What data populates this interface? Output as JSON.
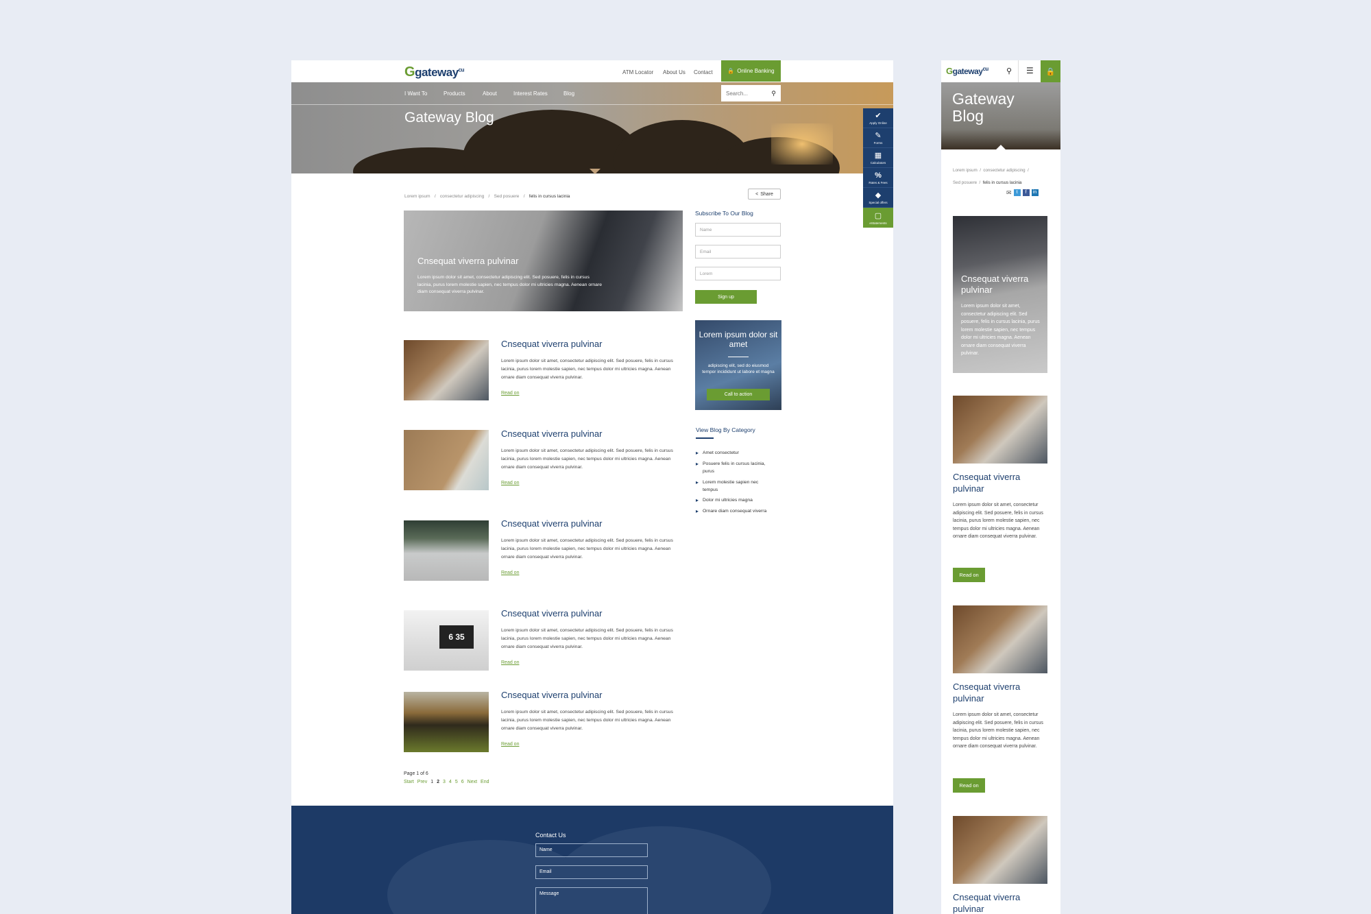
{
  "desktop": {
    "logo": {
      "mark": "G",
      "name": "gateway",
      "sup": "cu"
    },
    "top_links": [
      "ATM Locator",
      "About Us",
      "Contact"
    ],
    "online_banking": "Online Banking",
    "nav": [
      "I Want To",
      "Products",
      "About",
      "Interest Rates",
      "Blog"
    ],
    "search_placeholder": "Search...",
    "hero_title": "Gateway Blog",
    "breadcrumb": [
      "Lorem ipsum",
      "consectetur adipiscing",
      "Sed posuere",
      "felis in cursus lacinia"
    ],
    "share": "Share",
    "featured": {
      "title": "Cnsequat viverra pulvinar",
      "desc": "Lorem ipsum dolor sit amet, consectetur adipiscing elit. Sed posuere, felis in cursus lacinia, purus lorem molestie sapien, nec tempus dolor mi ultricies magna. Aenean ornare diam consequat viverra pulvinar."
    },
    "posts": [
      {
        "title": "Cnsequat viverra pulvinar",
        "desc": "Lorem ipsum dolor sit amet, consectetur adipiscing elit. Sed posuere, felis in cursus lacinia, purus lorem molestie sapien, nec tempus dolor mi ultricies magna. Aenean ornare diam consequat viverra pulvinar.",
        "read": "Read on",
        "image": "desk-tools"
      },
      {
        "title": "Cnsequat viverra pulvinar",
        "desc": "Lorem ipsum dolor sit amet, consectetur adipiscing elit. Sed posuere, felis in cursus lacinia, purus lorem molestie sapien, nec tempus dolor mi ultricies magna. Aenean ornare diam consequat viverra pulvinar.",
        "read": "Read on",
        "image": "beach"
      },
      {
        "title": "Cnsequat viverra pulvinar",
        "desc": "Lorem ipsum dolor sit amet, consectetur adipiscing elit. Sed posuere, felis in cursus lacinia, purus lorem molestie sapien, nec tempus dolor mi ultricies magna. Aenean ornare diam consequat viverra pulvinar.",
        "read": "Read on",
        "image": "motorbike"
      },
      {
        "title": "Cnsequat viverra pulvinar",
        "desc": "Lorem ipsum dolor sit amet, consectetur adipiscing elit. Sed posuere, felis in cursus lacinia, purus lorem molestie sapien, nec tempus dolor mi ultricies magna. Aenean ornare diam consequat viverra pulvinar.",
        "read": "Read on",
        "image": "laptop-clock",
        "clock": "6 35"
      },
      {
        "title": "Cnsequat viverra pulvinar",
        "desc": "Lorem ipsum dolor sit amet, consectetur adipiscing elit. Sed posuere, felis in cursus lacinia, purus lorem molestie sapien, nec tempus dolor mi ultricies magna. Aenean ornare diam consequat viverra pulvinar.",
        "read": "Read on",
        "image": "sunset-tree"
      }
    ],
    "pagination": {
      "label": "Page 1 of 6",
      "links": [
        "Start",
        "Prev",
        "1",
        "2",
        "3",
        "4",
        "5",
        "6",
        "Next",
        "End"
      ]
    },
    "subscribe": {
      "title": "Subscribe To Our Blog",
      "fields": [
        "Name",
        "Email",
        "Lorem"
      ],
      "button": "Sign up"
    },
    "cta": {
      "title": "Lorem ipsum dolor sit amet",
      "desc": "adipiscing elit, sed do eiusmod tempor incididunt ut labore et magna",
      "button": "Call to action"
    },
    "categories": {
      "title": "View Blog By Category",
      "items": [
        "Amet consectetur",
        "Posuere felis in cursus lacinia, purus",
        "Lorem molestie sapien nec tempus",
        "Dolor mi ultricies magna",
        "Ornare diam consequat viverra"
      ]
    },
    "float_bar": [
      {
        "label": "Apply Online",
        "icon": "check-icon"
      },
      {
        "label": "Forms",
        "icon": "edit-icon"
      },
      {
        "label": "Calculators",
        "icon": "calculator-icon"
      },
      {
        "label": "Rates & Fees",
        "icon": "percent-icon"
      },
      {
        "label": "Special offers",
        "icon": "tag-icon"
      },
      {
        "label": "eStatements",
        "icon": "monitor-icon"
      }
    ],
    "footer": {
      "title": "Contact Us",
      "fields": [
        "Name",
        "Email",
        "Message"
      ]
    }
  },
  "mobile": {
    "logo": {
      "mark": "G",
      "name": "gateway",
      "sup": "cu"
    },
    "hero_title": [
      "Gateway",
      "Blog"
    ],
    "breadcrumb": [
      "Lorem ipsum",
      "consectetur adipiscing",
      "Sed posuere",
      "felis in cursus lacinia"
    ],
    "featured": {
      "title": "Cnsequat viverra pulvinar",
      "desc": "Lorem ipsum dolor sit amet, consectetur adipiscing elit. Sed posuere, felis in cursus lacinia, purus lorem molestie sapien, nec tempus dolor mi ultricies magna. Aenean ornare diam consequat viverra pulvinar."
    },
    "posts": [
      {
        "title": "Cnsequat viverra pulvinar",
        "desc": "Lorem ipsum dolor sit amet, consectetur adipiscing elit. Sed posuere, felis in cursus lacinia, purus lorem molestie sapien, nec tempus dolor mi ultricies magna. Aenean ornare diam consequat viverra pulvinar.",
        "read": "Read on"
      },
      {
        "title": "Cnsequat viverra pulvinar",
        "desc": "Lorem ipsum dolor sit amet, consectetur adipiscing elit. Sed posuere, felis in cursus lacinia, purus lorem molestie sapien, nec tempus dolor mi ultricies magna. Aenean ornare diam consequat viverra pulvinar.",
        "read": "Read on"
      },
      {
        "title": "Cnsequat viverra pulvinar",
        "desc": "",
        "read": ""
      }
    ]
  },
  "colors": {
    "brand_green": "#6a9c32",
    "brand_navy": "#1d3f6e",
    "page_bg": "#e8ecf4"
  }
}
